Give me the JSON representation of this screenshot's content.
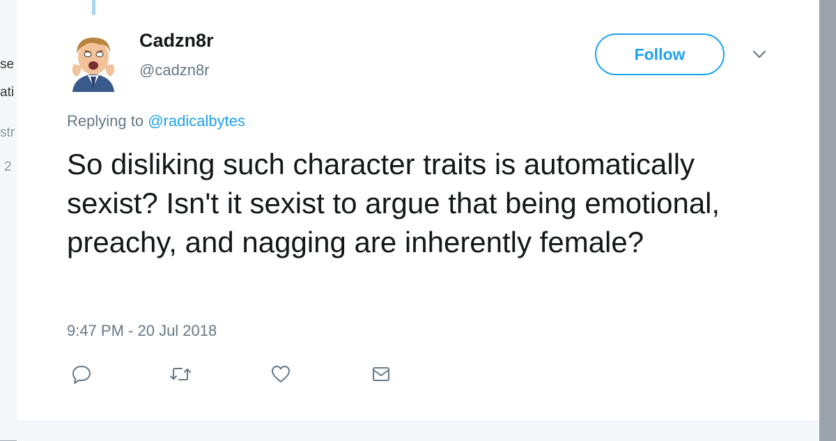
{
  "background_fragments": [
    "se",
    "ati",
    "str",
    "2"
  ],
  "tweet": {
    "display_name": "Cadzn8r",
    "username": "@cadzn8r",
    "follow_label": "Follow",
    "replying_prefix": "Replying to",
    "replying_to": "@radicalbytes",
    "text": "So disliking such character traits is automatically sexist? Isn't it sexist to argue that being emotional, preachy, and nagging are inherently female?",
    "timestamp": "9:47 PM - 20 Jul 2018"
  },
  "icons": {
    "reply": "reply-icon",
    "retweet": "retweet-icon",
    "like": "heart-icon",
    "direct_message": "envelope-icon",
    "more": "chevron-down-icon"
  },
  "colors": {
    "accent": "#1da1f2",
    "text_primary": "#14171a",
    "text_secondary": "#657786",
    "thread_line": "#a8d4f2"
  }
}
